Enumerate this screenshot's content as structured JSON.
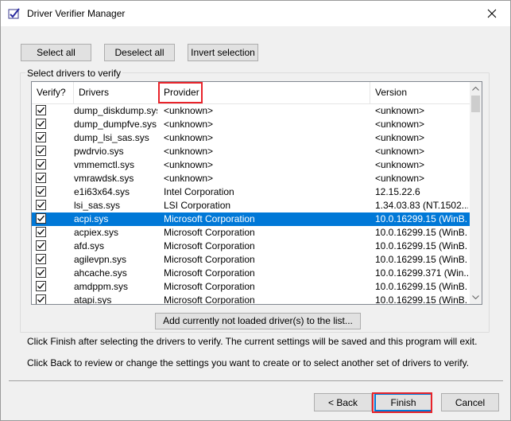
{
  "window": {
    "title": "Driver Verifier Manager"
  },
  "toolbar": {
    "select_all": "Select all",
    "deselect_all": "Deselect all",
    "invert_selection": "Invert selection"
  },
  "group_label": "Select drivers to verify",
  "table": {
    "columns": [
      "Verify?",
      "Drivers",
      "Provider",
      "Version"
    ],
    "rows": [
      {
        "checked": true,
        "driver": "dump_diskdump.sys",
        "provider": "<unknown>",
        "version": "<unknown>"
      },
      {
        "checked": true,
        "driver": "dump_dumpfve.sys",
        "provider": "<unknown>",
        "version": "<unknown>"
      },
      {
        "checked": true,
        "driver": "dump_lsi_sas.sys",
        "provider": "<unknown>",
        "version": "<unknown>"
      },
      {
        "checked": true,
        "driver": "pwdrvio.sys",
        "provider": "<unknown>",
        "version": "<unknown>"
      },
      {
        "checked": true,
        "driver": "vmmemctl.sys",
        "provider": "<unknown>",
        "version": "<unknown>"
      },
      {
        "checked": true,
        "driver": "vmrawdsk.sys",
        "provider": "<unknown>",
        "version": "<unknown>"
      },
      {
        "checked": true,
        "driver": "e1i63x64.sys",
        "provider": "Intel Corporation",
        "version": "12.15.22.6"
      },
      {
        "checked": true,
        "driver": "lsi_sas.sys",
        "provider": "LSI Corporation",
        "version": "1.34.03.83 (NT.1502..."
      },
      {
        "checked": true,
        "driver": "acpi.sys",
        "provider": "Microsoft Corporation",
        "version": "10.0.16299.15 (WinB...",
        "selected": true
      },
      {
        "checked": true,
        "driver": "acpiex.sys",
        "provider": "Microsoft Corporation",
        "version": "10.0.16299.15 (WinB..."
      },
      {
        "checked": true,
        "driver": "afd.sys",
        "provider": "Microsoft Corporation",
        "version": "10.0.16299.15 (WinB..."
      },
      {
        "checked": true,
        "driver": "agilevpn.sys",
        "provider": "Microsoft Corporation",
        "version": "10.0.16299.15 (WinB..."
      },
      {
        "checked": true,
        "driver": "ahcache.sys",
        "provider": "Microsoft Corporation",
        "version": "10.0.16299.371 (Win..."
      },
      {
        "checked": true,
        "driver": "amdppm.sys",
        "provider": "Microsoft Corporation",
        "version": "10.0.16299.15 (WinB..."
      },
      {
        "checked": true,
        "driver": "atapi.sys",
        "provider": "Microsoft Corporation",
        "version": "10.0.16299.15 (WinB..."
      }
    ]
  },
  "add_unloaded_button": "Add currently not loaded driver(s) to the list...",
  "info": {
    "line1": "Click Finish after selecting the drivers to verify. The current settings will be saved and this program will exit.",
    "line2": "Click Back to review or change the settings you want to create or to select another set of drivers to verify."
  },
  "footer": {
    "back": "< Back",
    "finish": "Finish",
    "cancel": "Cancel"
  },
  "colors": {
    "selection": "#0078d7",
    "annotation": "#e8232a",
    "window_bg": "#f0f0f0"
  }
}
